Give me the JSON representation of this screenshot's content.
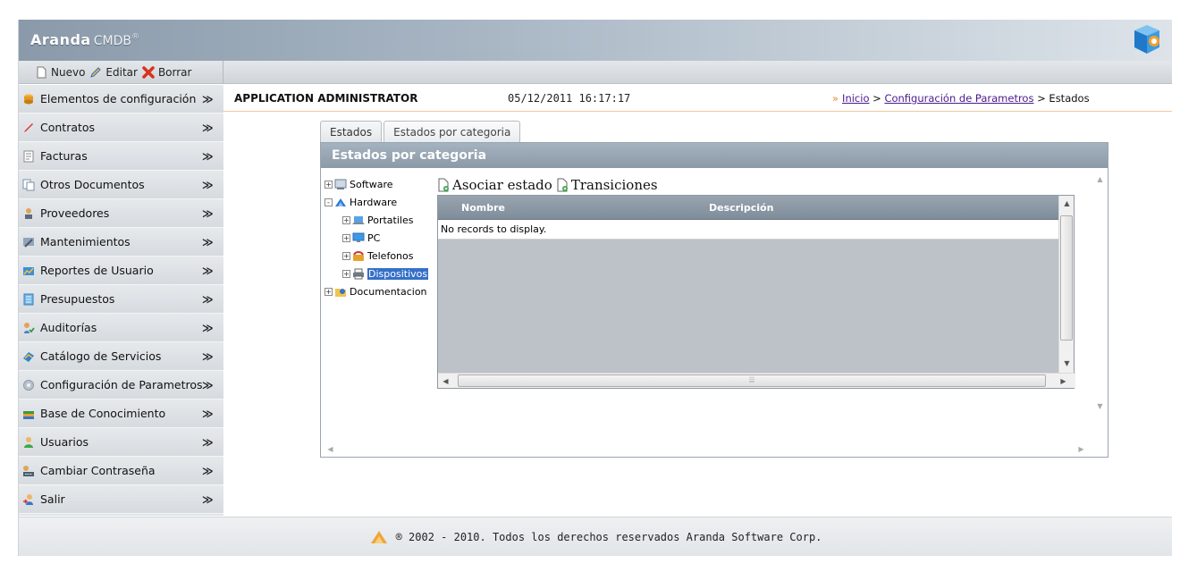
{
  "app": {
    "brand": "Aranda",
    "product": "CMDB",
    "reg": "®"
  },
  "toolbar": {
    "new_label": "Nuevo",
    "edit_label": "Editar",
    "delete_label": "Borrar"
  },
  "sidebar": {
    "items": [
      {
        "label": "Elementos de configuración",
        "icon": "database-icon"
      },
      {
        "label": "Contratos",
        "icon": "pen-icon"
      },
      {
        "label": "Facturas",
        "icon": "invoice-icon"
      },
      {
        "label": "Otros Documentos",
        "icon": "documents-icon"
      },
      {
        "label": "Proveedores",
        "icon": "supplier-icon"
      },
      {
        "label": "Mantenimientos",
        "icon": "maintenance-icon"
      },
      {
        "label": "Reportes de Usuario",
        "icon": "report-icon"
      },
      {
        "label": "Presupuestos",
        "icon": "budget-icon"
      },
      {
        "label": "Auditorías",
        "icon": "audit-icon"
      },
      {
        "label": "Catálogo de Servicios",
        "icon": "catalog-icon"
      },
      {
        "label": "Configuración de Parametros",
        "icon": "settings-icon"
      },
      {
        "label": "Base de Conocimiento",
        "icon": "knowledge-icon"
      },
      {
        "label": "Usuarios",
        "icon": "users-icon"
      },
      {
        "label": "Cambiar Contraseña",
        "icon": "password-icon"
      },
      {
        "label": "Salir",
        "icon": "exit-icon"
      }
    ],
    "chevron": "≫"
  },
  "infobar": {
    "user": "APPLICATION ADMINISTRATOR",
    "datetime": "05/12/2011 16:17:17",
    "breadcrumb": {
      "arrow": "»",
      "home": "Inicio",
      "sep": ">",
      "section": "Configuración de Parametros",
      "current": "Estados"
    }
  },
  "tabs": [
    {
      "label": "Estados",
      "active": false
    },
    {
      "label": "Estados por categoria",
      "active": true
    }
  ],
  "panel": {
    "title": "Estados por categoria",
    "tree": [
      {
        "label": "Software",
        "expander": "+"
      },
      {
        "label": "Hardware",
        "expander": "-"
      },
      {
        "label": "Portatiles",
        "expander": "+"
      },
      {
        "label": "PC",
        "expander": "+"
      },
      {
        "label": "Telefonos",
        "expander": "+"
      },
      {
        "label": "Dispositivos",
        "expander": "+",
        "selected": true
      },
      {
        "label": "Documentacion",
        "expander": "+"
      }
    ],
    "actions": {
      "associate": "Asociar estado",
      "transitions": "Transiciones"
    },
    "grid": {
      "columns": [
        "Nombre",
        "Descripción"
      ],
      "empty": "No records to display."
    }
  },
  "footer": {
    "text": "® 2002 - 2010. Todos los derechos reservados Aranda Software Corp."
  },
  "colors": {
    "header": "#a8b6c4",
    "panel_title": "#8c9aa8",
    "breadcrumb_link": "#4a1a8c",
    "selection": "#3570c8",
    "accent_orange": "#e58a2b"
  }
}
